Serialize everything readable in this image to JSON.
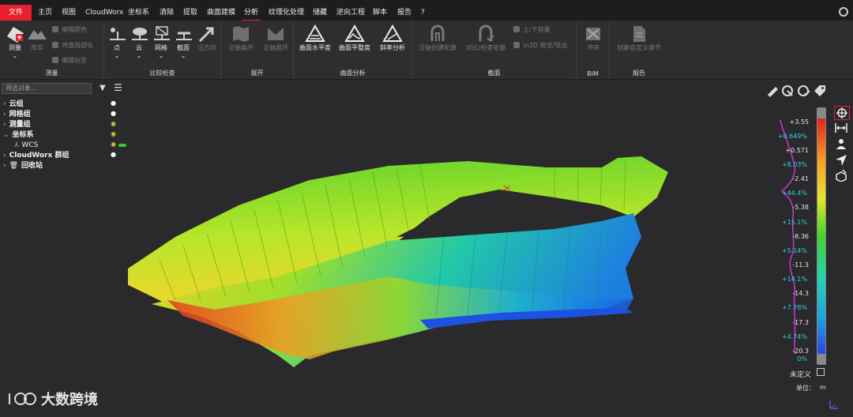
{
  "menu": {
    "file": "文件",
    "items": [
      "主页",
      "视图",
      "CloudWorx",
      "坐标系",
      "清除",
      "提取",
      "曲面建模",
      "分析",
      "纹理化处理",
      "储藏",
      "逆向工程",
      "脚本",
      "报告",
      "?"
    ],
    "active": "分析"
  },
  "ribbon": {
    "measure": {
      "label": "测量",
      "main": "测量",
      "library": "库存",
      "edit_color": "编辑颜色",
      "local": "将值局部化",
      "edit_tag": "编辑标签"
    },
    "compare": {
      "label": "比较检查",
      "tools": [
        "点",
        "云",
        "网格",
        "截面",
        "沿方向"
      ]
    },
    "unroll": {
      "label": "展开",
      "tools": [
        "沿轴展开",
        "沿轴展开"
      ]
    },
    "surface": {
      "label": "曲面分析",
      "tools": [
        "曲面水平度",
        "曲面平整度",
        "斜率分析"
      ]
    },
    "section": {
      "label": "截面",
      "tools": [
        "沿轴创建轮廓",
        "对比/检查轮廓"
      ],
      "up_down": "上/下容量",
      "export2d": "\\n2D 预览/导出"
    },
    "bim": {
      "label": "BIM",
      "tool": "冲突"
    },
    "report": {
      "label": "报告",
      "tool": "创建自定义章节"
    }
  },
  "tree": {
    "search_placeholder": "筛选对象...",
    "items": [
      {
        "label": "云组",
        "indent": 0,
        "expanded": false
      },
      {
        "label": "网格组",
        "indent": 0,
        "expanded": false
      },
      {
        "label": "测量组",
        "indent": 0,
        "expanded": false
      },
      {
        "label": "坐标系",
        "indent": 0,
        "expanded": true
      },
      {
        "label": "WCS",
        "indent": 1,
        "expanded": false
      },
      {
        "label": "CloudWorx 群组",
        "indent": 0,
        "expanded": false
      },
      {
        "label": "回收站",
        "indent": 0,
        "expanded": false
      }
    ]
  },
  "scale": {
    "values": [
      "+3.55",
      "+0.571",
      "-2.41",
      "-5.38",
      "-8.36",
      "-11.3",
      "-14.3",
      "-17.3",
      "-20.3"
    ],
    "percents": [
      "+0.649%",
      "+8.03%",
      "+44.4%",
      "+15.1%",
      "+5.14%",
      "+14.1%",
      "+7.78%",
      "+4.74%",
      "0%"
    ],
    "undefined_label": "未定义",
    "unit_label": "单位：",
    "unit": "m"
  },
  "watermark": "大数跨境",
  "colors": {
    "accent": "#e8202e",
    "tree_icon": "#e3d23a",
    "toggle": "#2ecc40",
    "percent": "#33d0e6"
  }
}
